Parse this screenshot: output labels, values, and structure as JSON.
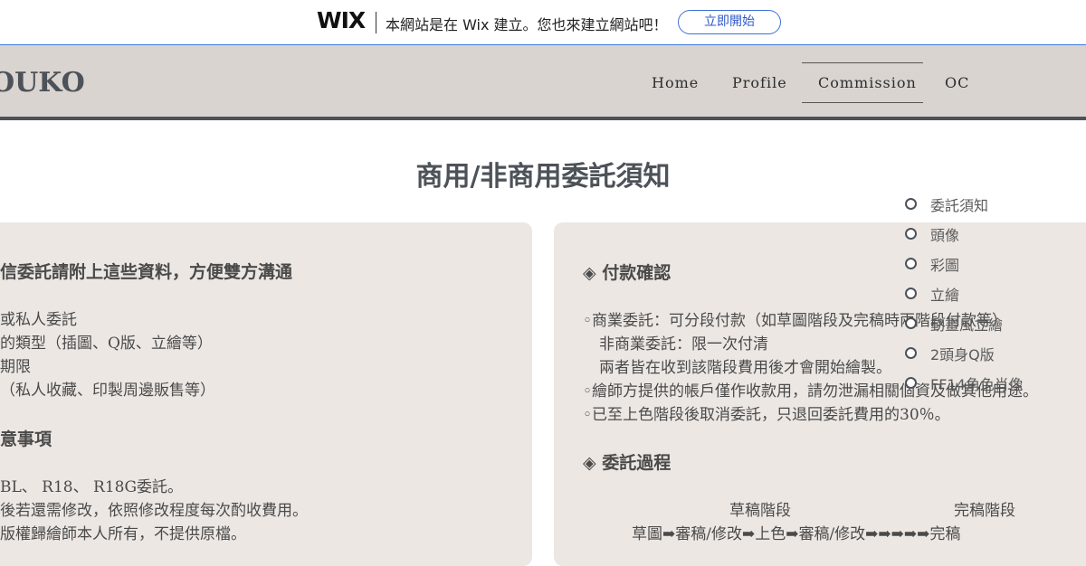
{
  "wix_bar": {
    "logo": "WIX",
    "message": "本網站是在 Wix 建立。您也來建立網站吧！",
    "cta": "立即開始"
  },
  "site": {
    "logo": "OUKO",
    "nav": [
      "Home",
      "Profile",
      "Commission",
      "OC"
    ]
  },
  "page_title": "商用/非商用委託須知",
  "side_nav": [
    "委託須知",
    "頭像",
    "彩圖",
    "立繪",
    "動畫風立繪",
    "2頭身Q版",
    "FF14角色肖像"
  ],
  "left_card": {
    "heading1": "信委託請附上這些資料，方便雙方溝通",
    "lines1": [
      "或私人委託",
      "的類型（插圖、Q版、立繪等）",
      "期限",
      "（私人收藏、印製周邊販售等）"
    ],
    "heading2": "意事項",
    "lines2": [
      "BL、 R18、 R18G委託。",
      "後若還需修改，依照修改程度每次酌收費用。",
      "版權歸繪師本人所有，不提供原檔。"
    ]
  },
  "right_card": {
    "heading1": "◈ 付款確認",
    "lines1": [
      "◦商業委託：可分段付款（如草圖階段及完稿時兩階段付款等）",
      "非商業委託：限一次付清",
      "兩者皆在收到該階段費用後才會開始繪製。",
      "◦繪師方提供的帳戶僅作收款用，請勿泄漏相關個資及做其他用途。",
      "◦已至上色階段後取消委託，只退回委託費用的30％。"
    ],
    "heading2": "◈ 委託過程",
    "stage_labels": [
      "草稿階段",
      "完稿階段"
    ],
    "process": "草圖➡審稿/修改➡上色➡審稿/修改➡➡➡➡➡完稿"
  }
}
